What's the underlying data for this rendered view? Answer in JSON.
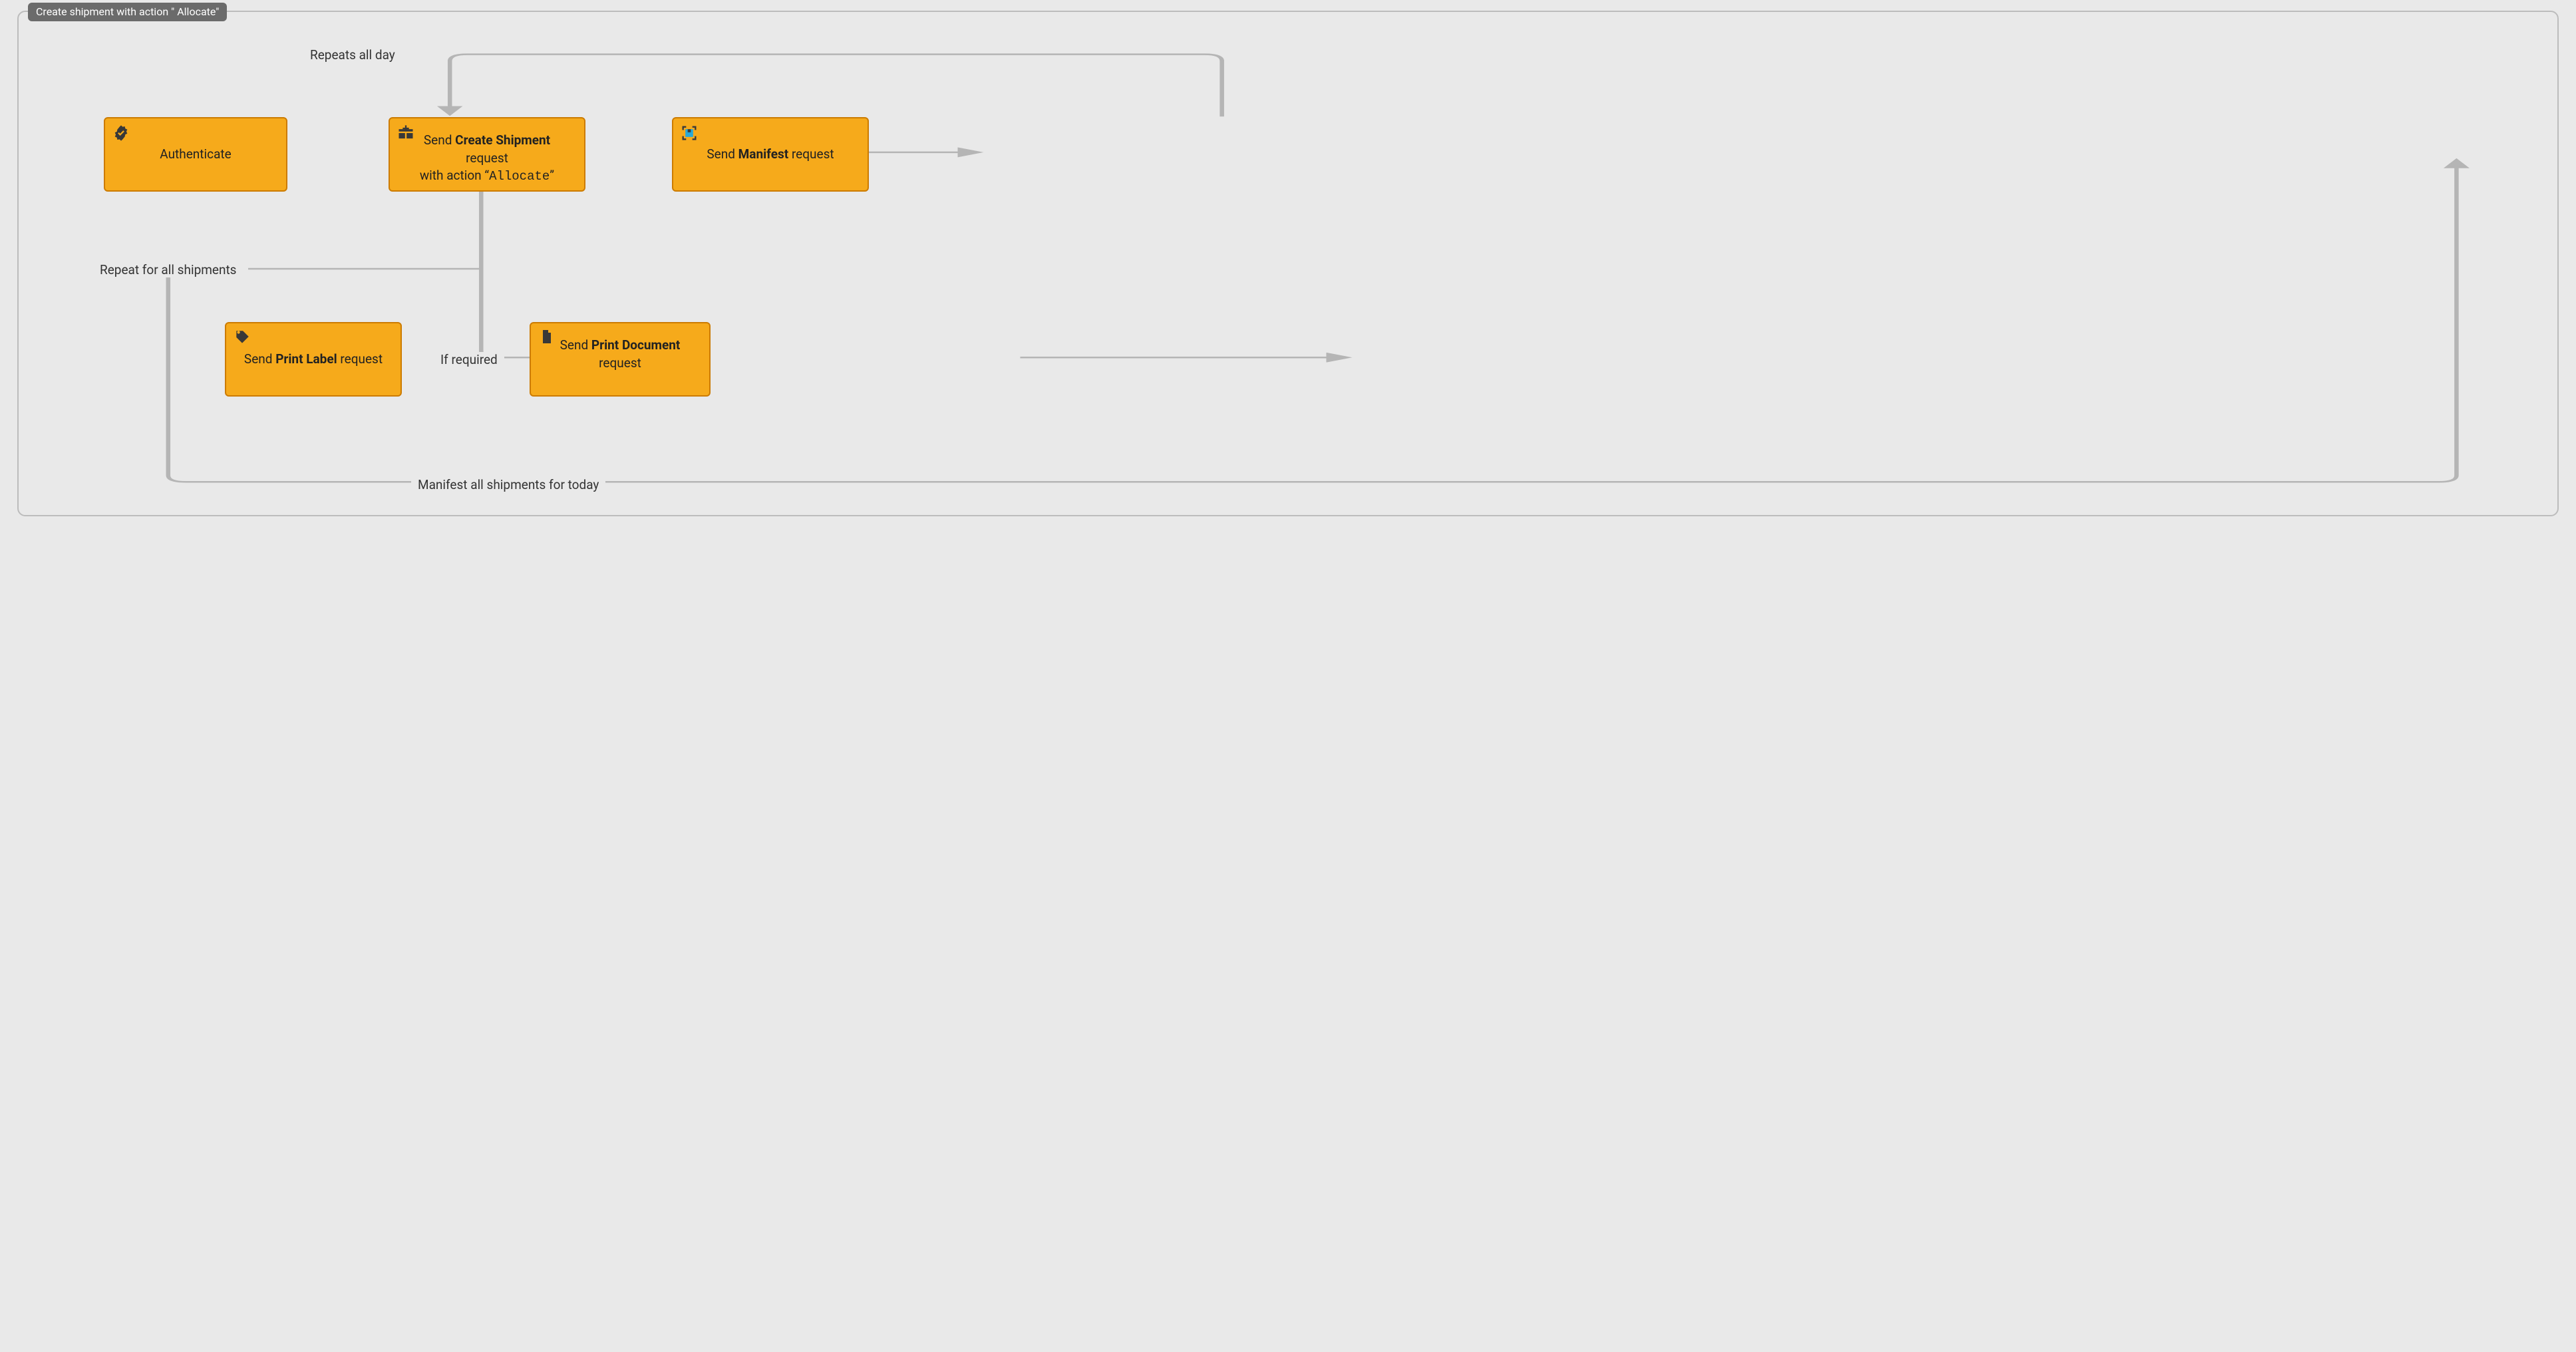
{
  "title": "Create shipment with action \" Allocate\"",
  "nodes": {
    "authenticate": {
      "text1": "Authenticate",
      "icon": "verified-badge-icon"
    },
    "create_shipment": {
      "text_pre": "Send ",
      "text_bold": "Create Shipment",
      "text_post": " request",
      "text2_pre": "with action “",
      "text2_code": "Allocate",
      "text2_post": "”",
      "icon": "package-plus-icon"
    },
    "manifest": {
      "text_pre": "Send ",
      "text_bold": "Manifest",
      "text_post": " request",
      "icon": "box-scan-icon"
    },
    "print_label": {
      "text_pre": "Send ",
      "text_bold": "Print Label",
      "text_post": " request",
      "icon": "tag-icon"
    },
    "print_document": {
      "text_pre": "Send ",
      "text_bold": "Print Document",
      "text2": "request",
      "icon": "document-icon"
    }
  },
  "edges": {
    "repeats_all_day": "Repeats all day",
    "repeat_for_all_shipments": "Repeat for all shipments",
    "if_required": "If required",
    "manifest_all_today": "Manifest all shipments for today"
  },
  "colors": {
    "box_fill": "#f6aa1b",
    "box_border": "#cc7b00",
    "frame_border": "#bcbcbc",
    "bg": "#e9e9e9",
    "pill_bg": "#6b6b6b",
    "arrow": "#b5b5b5"
  }
}
